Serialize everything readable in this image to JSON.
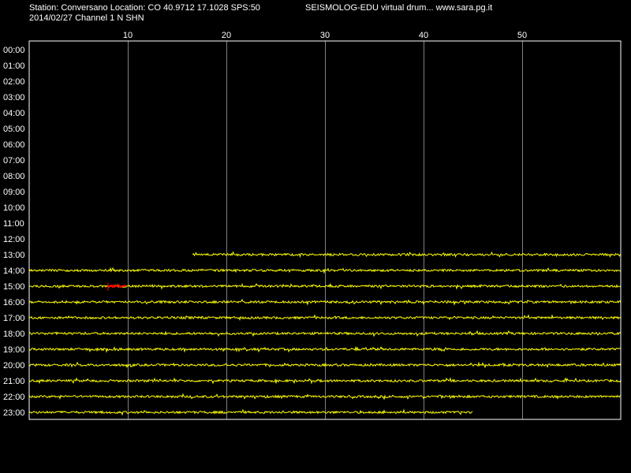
{
  "header": {
    "station_line": "Station: Conversano Location: CO 40.9712 17.1028 SPS:50",
    "app_line": "SEISMOLOG-EDU virtual drum... www.sara.pg.it",
    "date_line": "2014/02/27  Channel 1 N SHN"
  },
  "colors": {
    "background": "#000000",
    "plot_border": "#ffffff",
    "gridline": "#808080",
    "trace": "#ffff00",
    "event": "#ff0000",
    "text": "#ffffff"
  },
  "drum": {
    "minute_ticks": [
      "10",
      "20",
      "30",
      "40",
      "50"
    ],
    "hour_labels": [
      "00:00",
      "01:00",
      "02:00",
      "03:00",
      "04:00",
      "05:00",
      "06:00",
      "07:00",
      "08:00",
      "09:00",
      "10:00",
      "11:00",
      "12:00",
      "13:00",
      "14:00",
      "15:00",
      "16:00",
      "17:00",
      "18:00",
      "19:00",
      "20:00",
      "21:00",
      "22:00",
      "23:00"
    ],
    "traces": [
      {
        "hour": 13,
        "start_min": 16.6,
        "end_min": 60
      },
      {
        "hour": 14,
        "start_min": 0,
        "end_min": 60
      },
      {
        "hour": 15,
        "start_min": 0,
        "end_min": 60,
        "event": {
          "start_min": 8.0,
          "end_min": 9.9
        }
      },
      {
        "hour": 16,
        "start_min": 0,
        "end_min": 60
      },
      {
        "hour": 17,
        "start_min": 0,
        "end_min": 60
      },
      {
        "hour": 18,
        "start_min": 0,
        "end_min": 60
      },
      {
        "hour": 19,
        "start_min": 0,
        "end_min": 60
      },
      {
        "hour": 20,
        "start_min": 0,
        "end_min": 60
      },
      {
        "hour": 21,
        "start_min": 0,
        "end_min": 60
      },
      {
        "hour": 22,
        "start_min": 0,
        "end_min": 60
      },
      {
        "hour": 23,
        "start_min": 0,
        "end_min": 45.0
      }
    ]
  }
}
